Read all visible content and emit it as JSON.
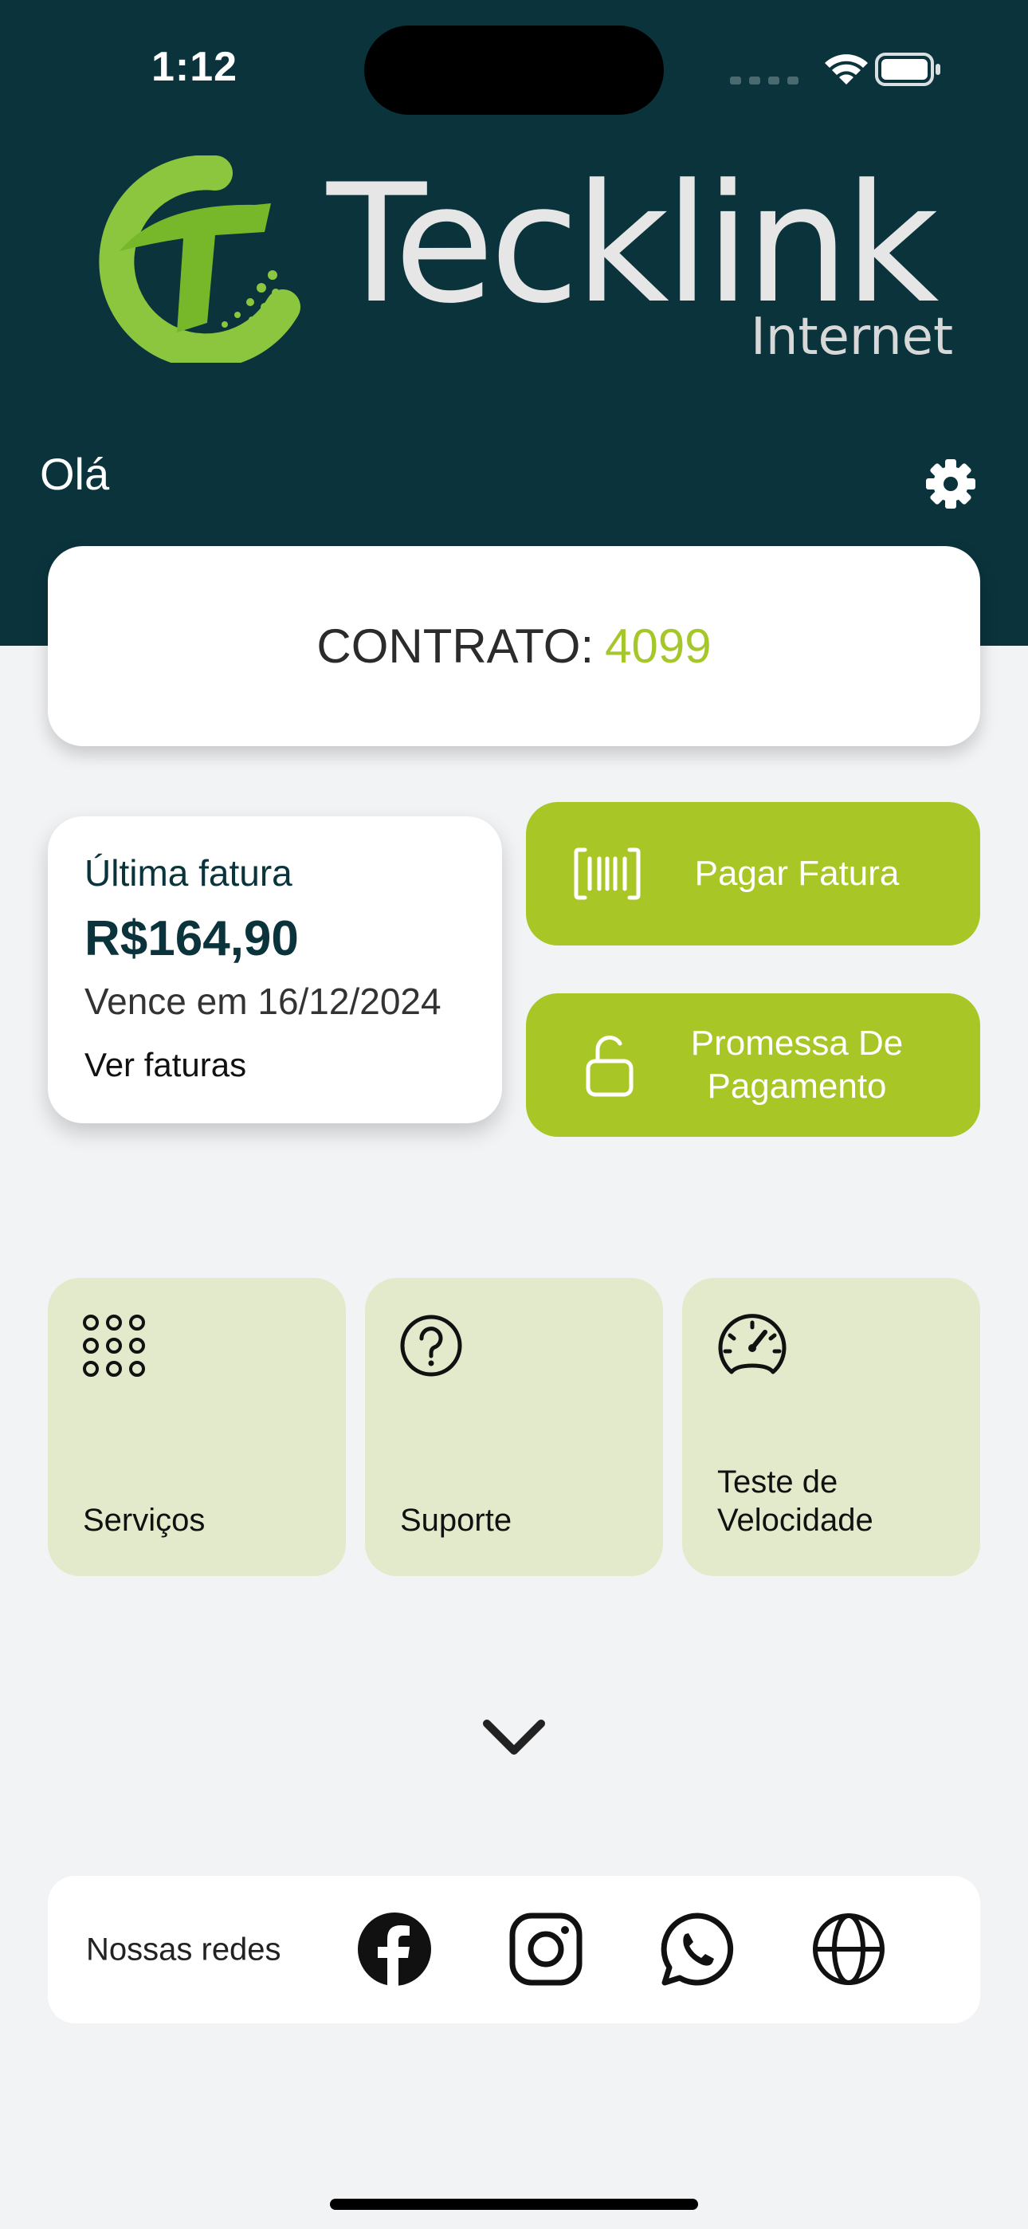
{
  "status_bar": {
    "time": "1:12"
  },
  "brand": {
    "name": "Tecklink",
    "subtitle": "Internet",
    "logo_icon": "tecklink-swoosh-logo",
    "colors": {
      "header_bg": "#0a333c",
      "accent_green": "#a8c626",
      "tile_bg": "#e3eacb",
      "page_bg": "#f2f3f5"
    }
  },
  "header": {
    "greeting": "Olá",
    "settings_icon": "gear-icon"
  },
  "contract": {
    "label": "CONTRATO:",
    "number": "4099"
  },
  "invoice": {
    "title": "Última fatura",
    "amount": "R$164,90",
    "due": "Vence em 16/12/2024",
    "link": "Ver faturas"
  },
  "actions": {
    "pay": {
      "label": "Pagar Fatura",
      "icon": "barcode-icon"
    },
    "promise": {
      "label": "Promessa De Pagamento",
      "icon": "unlock-icon"
    }
  },
  "tiles": [
    {
      "label": "Serviços",
      "icon": "grid-dots-icon"
    },
    {
      "label": "Suporte",
      "icon": "help-circle-icon"
    },
    {
      "label": "Teste de Velocidade",
      "icon": "speedometer-icon"
    }
  ],
  "expand_icon": "chevron-down-icon",
  "social": {
    "label": "Nossas redes",
    "links": [
      {
        "name": "facebook",
        "icon": "facebook-icon"
      },
      {
        "name": "instagram",
        "icon": "instagram-icon"
      },
      {
        "name": "whatsapp",
        "icon": "whatsapp-icon"
      },
      {
        "name": "website",
        "icon": "globe-icon"
      }
    ]
  }
}
